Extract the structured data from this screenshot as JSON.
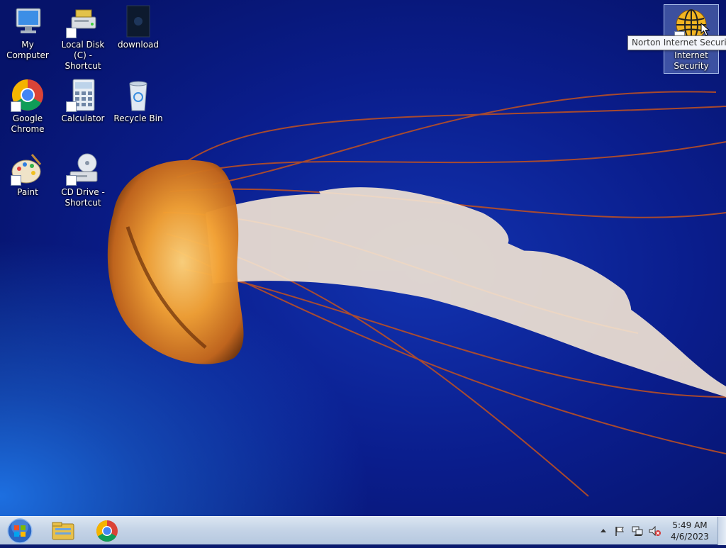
{
  "desktop": {
    "icons": [
      {
        "label": "My Computer"
      },
      {
        "label": "Local Disk (C) - Shortcut"
      },
      {
        "label": "download"
      },
      {
        "label": "Google Chrome"
      },
      {
        "label": "Calculator"
      },
      {
        "label": "Recycle Bin"
      },
      {
        "label": "Paint"
      },
      {
        "label": "CD Drive - Shortcut"
      },
      {
        "label": "Internet Security"
      }
    ],
    "tooltip": "Norton Internet Security"
  },
  "taskbar": {
    "pinned": [
      {
        "icon": "windows-explorer-icon"
      },
      {
        "icon": "google-chrome-icon"
      }
    ],
    "tray": {
      "icons": [
        "show-hidden-icons-arrow",
        "action-center-flag-icon",
        "network-icon",
        "volume-muted-icon"
      ],
      "time": "5:49 AM",
      "date": "4/6/2023"
    }
  },
  "colors": {
    "wallpaper_blue": "#0a1d8c",
    "taskbar": "#c5d4e7",
    "jelly_orange": "#e8891f"
  }
}
